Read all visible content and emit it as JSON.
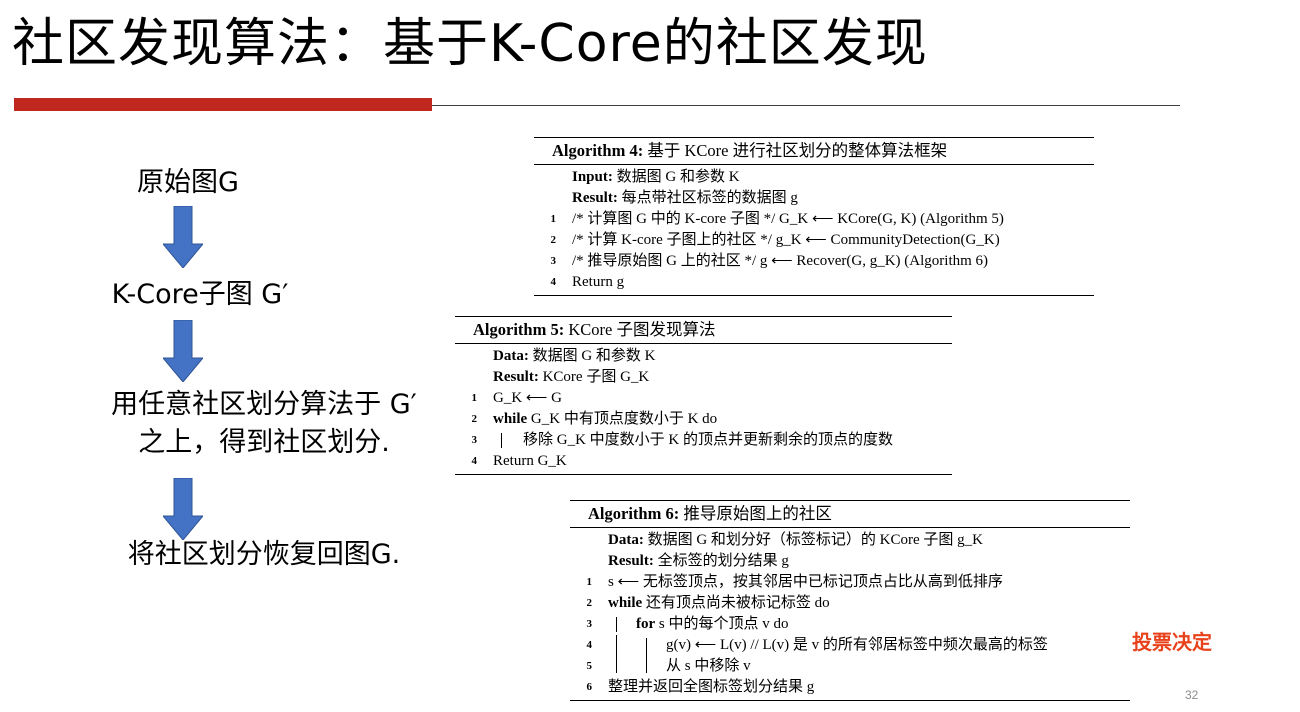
{
  "title": "社区发现算法：基于K-Core的社区发现",
  "flow": {
    "step1": "原始图G",
    "step2": "K-Core子图 G′",
    "step3_line1": "用任意社区划分算法于 G′",
    "step3_line2": "之上，得到社区划分.",
    "step4": "将社区划分恢复回图G."
  },
  "algo4": {
    "header_bold": "Algorithm 4:",
    "header_rest": " 基于 KCore 进行社区划分的整体算法框架",
    "lines": [
      {
        "num": "",
        "bold": "Input:",
        "text": " 数据图 G 和参数 K"
      },
      {
        "num": "",
        "bold": "Result:",
        "text": " 每点带社区标签的数据图 g"
      },
      {
        "num": "1",
        "bold": "",
        "text": "/* 计算图 G 中的 K-core 子图 */ G_K ⟵ KCore(G, K) (Algorithm 5)"
      },
      {
        "num": "2",
        "bold": "",
        "text": "/* 计算 K-core 子图上的社区 */ g_K ⟵ CommunityDetection(G_K)"
      },
      {
        "num": "3",
        "bold": "",
        "text": "/* 推导原始图 G 上的社区 */ g ⟵ Recover(G, g_K) (Algorithm 6)"
      },
      {
        "num": "4",
        "bold": "",
        "text": "Return g"
      }
    ]
  },
  "algo5": {
    "header_bold": "Algorithm 5:",
    "header_rest": " KCore 子图发现算法",
    "lines": [
      {
        "num": "",
        "bold": "Data:",
        "text": " 数据图 G 和参数 K"
      },
      {
        "num": "",
        "bold": "Result:",
        "text": " KCore 子图 G_K"
      },
      {
        "num": "1",
        "bold": "",
        "text": "G_K ⟵ G"
      },
      {
        "num": "2",
        "bold": "while",
        "text": " G_K 中有顶点度数小于 K do"
      },
      {
        "num": "3",
        "bold": "",
        "text": "移除 G_K 中度数小于 K 的顶点并更新剩余的顶点的度数"
      },
      {
        "num": "4",
        "bold": "",
        "text": "Return G_K"
      }
    ]
  },
  "algo6": {
    "header_bold": "Algorithm 6:",
    "header_rest": " 推导原始图上的社区",
    "lines": [
      {
        "num": "",
        "bold": "Data:",
        "text": " 数据图 G 和划分好（标签标记）的 KCore 子图 g_K"
      },
      {
        "num": "",
        "bold": "Result:",
        "text": " 全标签的划分结果 g"
      },
      {
        "num": "1",
        "bold": "",
        "text": "s ⟵ 无标签顶点，按其邻居中已标记顶点占比从高到低排序"
      },
      {
        "num": "2",
        "bold": "while",
        "text": " 还有顶点尚未被标记标签 do"
      },
      {
        "num": "3",
        "bold": "for",
        "text": " s 中的每个顶点 v do"
      },
      {
        "num": "4",
        "bold": "",
        "text": "g(v) ⟵ L(v) // L(v) 是 v 的所有邻居标签中频次最高的标签"
      },
      {
        "num": "5",
        "bold": "",
        "text": "从 s 中移除 v"
      },
      {
        "num": "6",
        "bold": "",
        "text": "整理并返回全图标签划分结果 g"
      }
    ]
  },
  "annotation": "投票决定",
  "page_number": "32",
  "colors": {
    "accent_red": "#c0271e",
    "arrow_blue": "#4472c4",
    "annotation_red": "#e8421c"
  }
}
